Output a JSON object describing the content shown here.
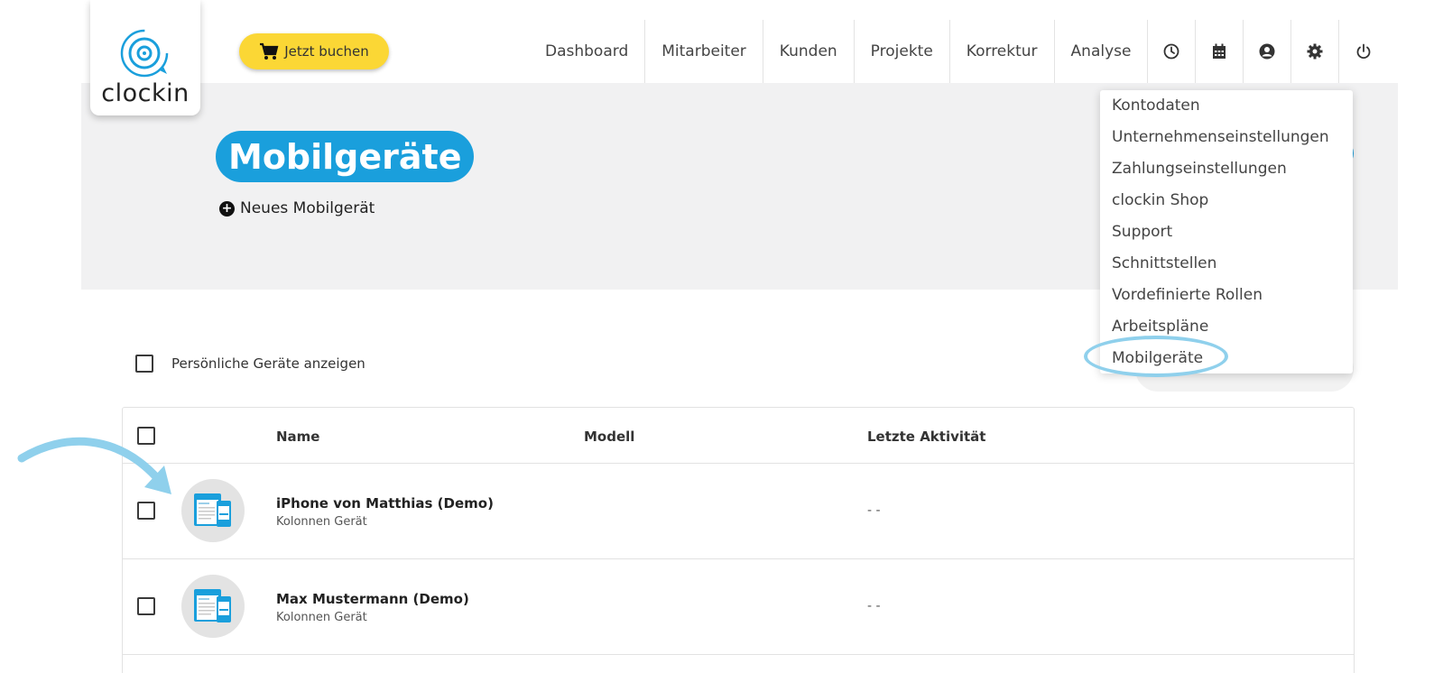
{
  "app": {
    "logo_text": "clockin",
    "book_button": "Jetzt buchen"
  },
  "nav": {
    "items": [
      "Dashboard",
      "Mitarbeiter",
      "Kunden",
      "Projekte",
      "Korrektur",
      "Analyse"
    ],
    "icons": [
      "clock-icon",
      "calendar-icon",
      "user-circle-icon",
      "gear-icon",
      "power-icon"
    ]
  },
  "page": {
    "title": "Mobilgeräte",
    "new_device_label": "Neues Mobilgerät"
  },
  "settings_menu": {
    "items": [
      "Kontodaten",
      "Unternehmenseinstellungen",
      "Zahlungseinstellungen",
      "clockin Shop",
      "Support",
      "Schnittstellen",
      "Vordefinierte Rollen",
      "Arbeitspläne",
      "Mobilgeräte"
    ],
    "highlighted": "Mobilgeräte"
  },
  "filters": {
    "personal_devices_label": "Persönliche Geräte anzeigen"
  },
  "table": {
    "columns": [
      "Name",
      "Modell",
      "Letzte Aktivität"
    ],
    "rows": [
      {
        "name": "iPhone von Matthias (Demo)",
        "subtitle": "Kolonnen Gerät",
        "model": "",
        "last_activity": "- -"
      },
      {
        "name": "Max Mustermann (Demo)",
        "subtitle": "Kolonnen Gerät",
        "model": "",
        "last_activity": "- -"
      }
    ]
  },
  "colors": {
    "brand_blue": "#1a9fdc",
    "book_yellow": "#fbd735",
    "annotation_blue": "#8fd0ec",
    "banner_bg": "#f1f1f2"
  }
}
